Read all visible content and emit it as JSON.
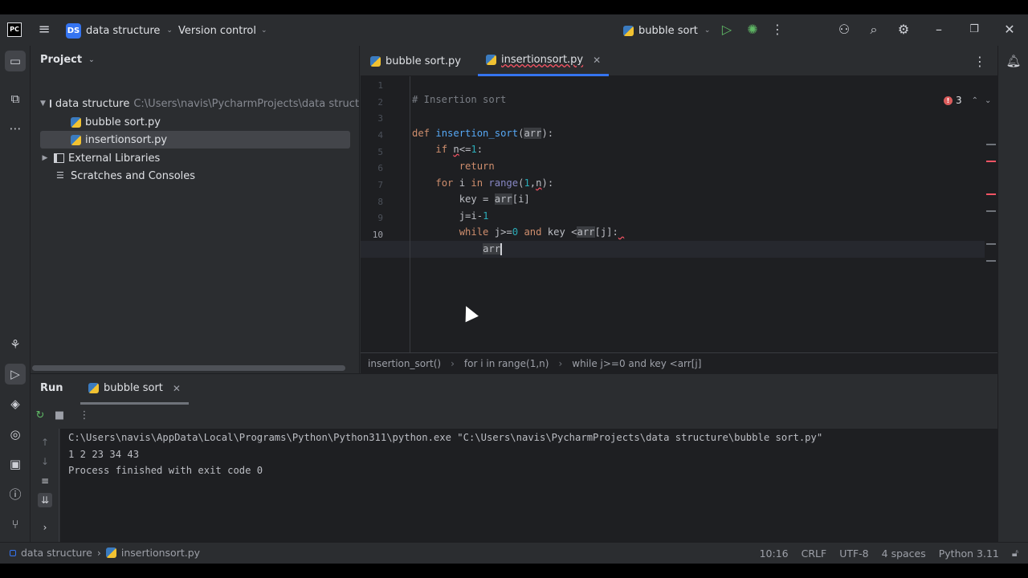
{
  "titlebar": {
    "logo": "PC",
    "project_badge": "DS",
    "project_name": "data structure",
    "version_control": "Version control",
    "run_config": "bubble sort"
  },
  "project_panel": {
    "title": "Project",
    "root_name": "data structure",
    "root_path": "C:\\Users\\navis\\PycharmProjects\\data structure",
    "files": [
      "bubble sort.py",
      "insertionsort.py"
    ],
    "external_libraries": "External Libraries",
    "scratches": "Scratches and Consoles"
  },
  "editor": {
    "tabs": [
      {
        "label": "bubble sort.py",
        "active": false
      },
      {
        "label": "insertionsort.py",
        "active": true
      }
    ],
    "error_count": "3",
    "line_numbers": [
      "1",
      "2",
      "3",
      "4",
      "5",
      "6",
      "7",
      "8",
      "9",
      "10"
    ],
    "current_line": 10,
    "breadcrumb": [
      "insertion_sort()",
      "for i in range(1,n)",
      "while j>=0 and key <arr[j]"
    ]
  },
  "run_panel": {
    "title": "Run",
    "tab_label": "bubble sort",
    "console_lines": [
      "C:\\Users\\navis\\AppData\\Local\\Programs\\Python\\Python311\\python.exe \"C:\\Users\\navis\\PycharmProjects\\data structure\\bubble sort.py\"",
      "1 2 23 34 43",
      "Process finished with exit code 0"
    ]
  },
  "statusbar": {
    "project": "data structure",
    "file": "insertionsort.py",
    "position": "10:16",
    "line_ending": "CRLF",
    "encoding": "UTF-8",
    "indent": "4 spaces",
    "interpreter": "Python 3.11"
  },
  "colors": {
    "accent": "#3574f0",
    "error": "#f75464",
    "keyword": "#cf8e6d",
    "function": "#56a8f5",
    "number": "#2aacb8",
    "comment": "#7a7e85"
  }
}
